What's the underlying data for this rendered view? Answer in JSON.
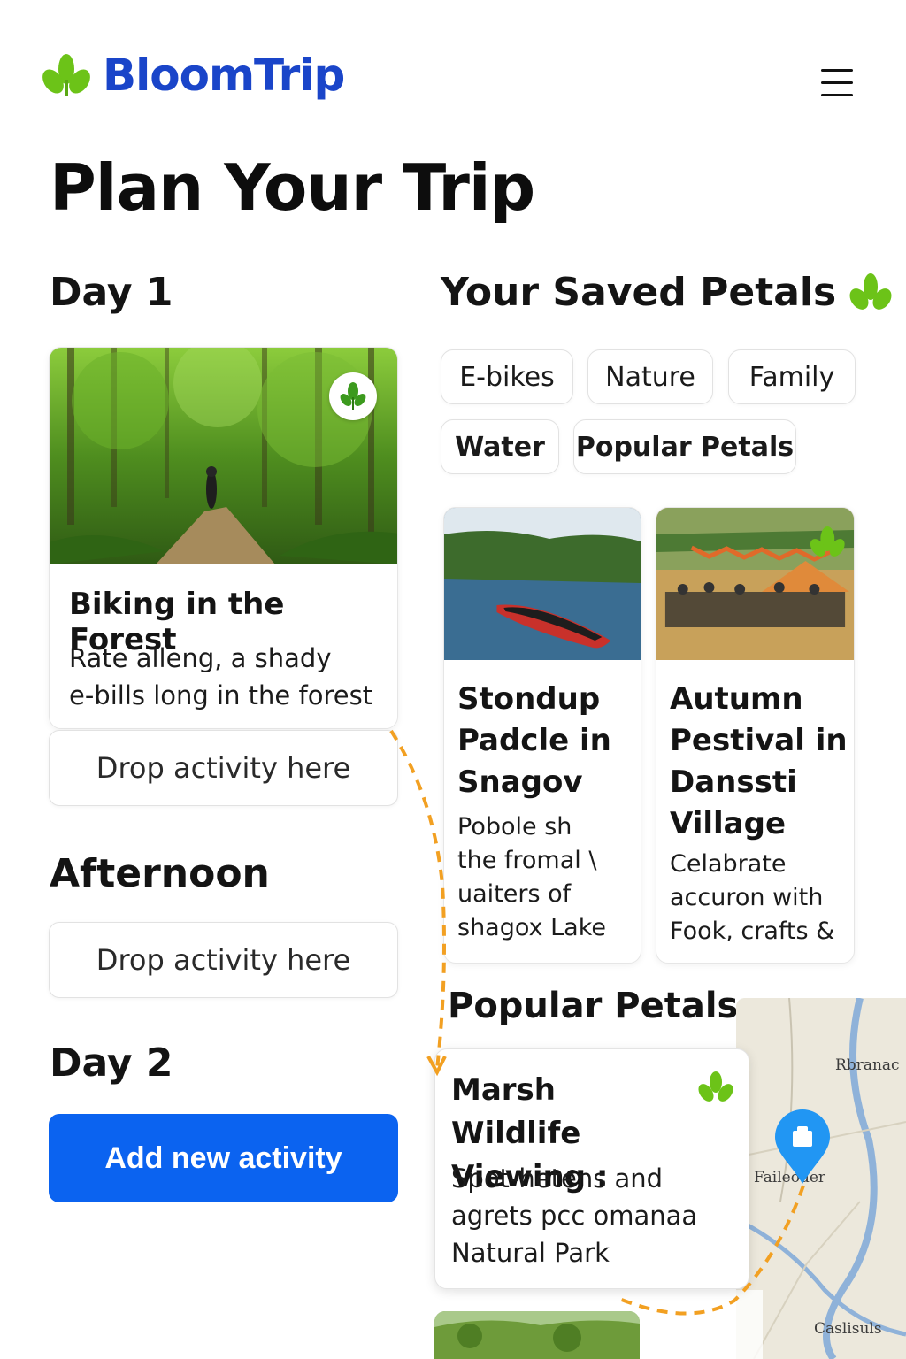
{
  "app": {
    "name": "BloomTrip"
  },
  "page": {
    "title": "Plan Your Trip"
  },
  "itinerary": {
    "day1_label": "Day 1",
    "afternoon_label": "Afternoon",
    "day2_label": "Day 2",
    "activity": {
      "title": "Biking in the Forest",
      "desc_line1": "Rate alleng, a shady",
      "desc_line2": "e-bills long in the forest",
      "badge_icon": "sprout-icon"
    },
    "drop_placeholder": "Drop activity here",
    "add_button": "Add new activity"
  },
  "saved": {
    "heading": "Your Saved Petals",
    "filters": [
      "E-bikes",
      "Nature",
      "Family",
      "Water",
      "Popular Petals"
    ],
    "cards": [
      {
        "title_lines": [
          "Stondup",
          "Padcle in",
          "Snagov"
        ],
        "desc_lines": [
          "Pobole sh",
          "the fromal \\",
          "uaiters of",
          "shagox Lake"
        ]
      },
      {
        "title_lines": [
          "Autumn",
          "Pestival in",
          "Danssti",
          "Village"
        ],
        "desc_lines": [
          "Celabrate",
          "accuron with",
          "Fook, crafts &"
        ]
      }
    ]
  },
  "popular": {
    "heading": "Popular Petals",
    "card": {
      "title_line1": "Marsh Wildlife",
      "title_line2": "Viewing :",
      "desc_lines": [
        "Spot-hetens and",
        "agrets pcc omanaa",
        "Natural Park"
      ]
    }
  },
  "map": {
    "labels": [
      "Rbranac",
      "Faileoder",
      "Caslisuls"
    ]
  },
  "colors": {
    "brand_blue": "#1a45c9",
    "button_blue": "#0b63f0",
    "sprout_green": "#6cc318",
    "route_orange": "#f2a022",
    "pin_blue": "#2196f3"
  }
}
